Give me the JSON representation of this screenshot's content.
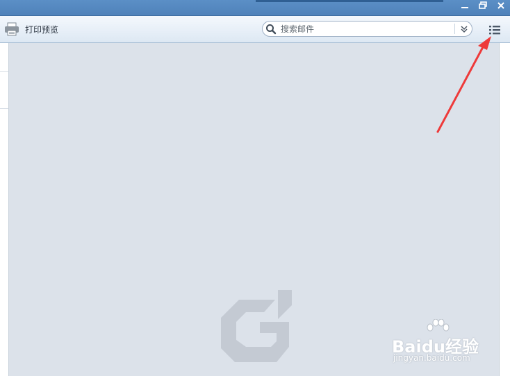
{
  "window": {
    "minimize_icon": "minimize-icon",
    "restore_icon": "restore-icon",
    "close_icon": "close-icon"
  },
  "toolbar": {
    "print_preview_label": "打印预览",
    "print_icon": "printer-icon",
    "menu_icon": "list-menu-icon"
  },
  "search": {
    "placeholder": "搜索邮件",
    "value": "",
    "dropdown_icon": "double-chevron-down-icon"
  },
  "watermark": {
    "brand": "Baidu经验",
    "url": "jingyan.baidu.com"
  },
  "annotation": {
    "arrow_color": "#ee3a3a"
  },
  "colors": {
    "titlebar": "#5b8fc6",
    "content_bg": "#dce2ea"
  }
}
